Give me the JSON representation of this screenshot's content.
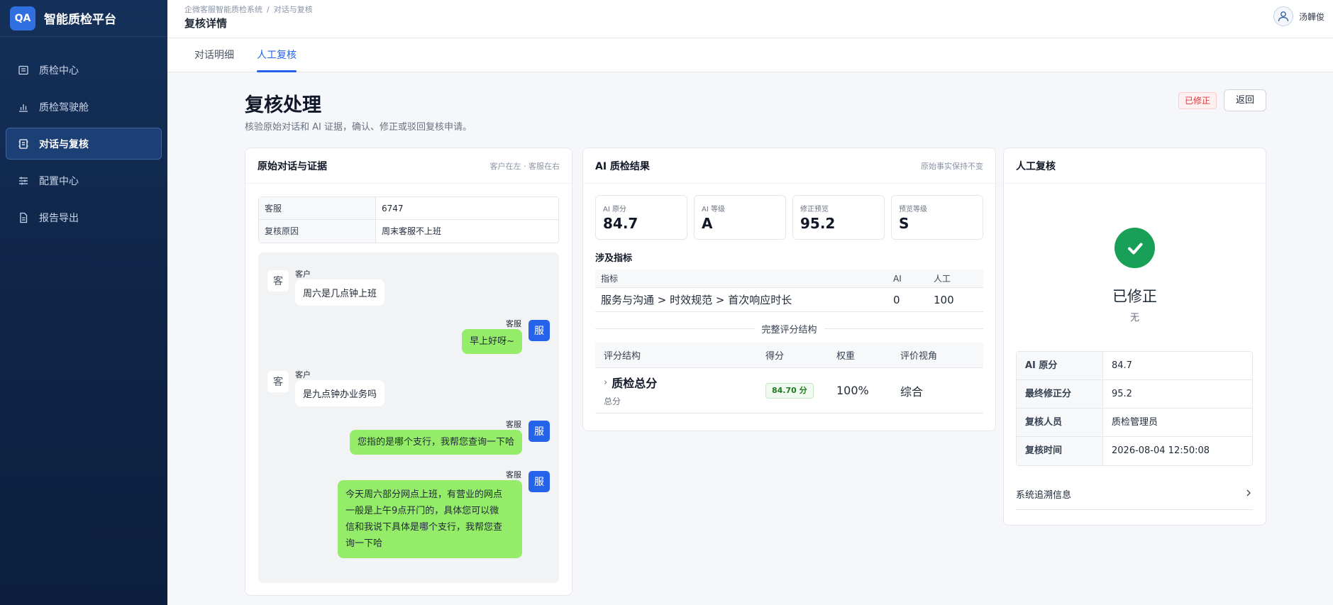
{
  "brand": {
    "logo": "QA",
    "name": "智能质检平台"
  },
  "sidebar": {
    "items": [
      {
        "label": "质检中心",
        "icon": "list-icon"
      },
      {
        "label": "质检驾驶舱",
        "icon": "bar-chart-icon"
      },
      {
        "label": "对话与复核",
        "icon": "chat-review-icon",
        "active": true
      },
      {
        "label": "配置中心",
        "icon": "sliders-icon"
      },
      {
        "label": "报告导出",
        "icon": "document-icon"
      }
    ]
  },
  "header": {
    "breadcrumb": [
      "企微客服智能质检系统",
      "对话与复核"
    ],
    "title": "复核详情",
    "user": "汤韡俊"
  },
  "tabs": [
    {
      "label": "对话明细"
    },
    {
      "label": "人工复核",
      "active": true
    }
  ],
  "main": {
    "title": "复核处理",
    "subtitle": "核验原始对话和 AI 证据，确认、修正或驳回复核申请。",
    "status_tag": "已修正",
    "back_label": "返回"
  },
  "left_card": {
    "title": "原始对话与证据",
    "extra": "客户在左 · 客服在右",
    "info": [
      {
        "key": "客服",
        "value": "6747"
      },
      {
        "key": "复核原因",
        "value": "周末客服不上班"
      }
    ],
    "messages": [
      {
        "role": "customer",
        "avatar": "客",
        "sender": "客户",
        "text": "周六是几点钟上班"
      },
      {
        "role": "agent",
        "avatar": "服",
        "sender": "客服",
        "text": "早上好呀~"
      },
      {
        "role": "customer",
        "avatar": "客",
        "sender": "客户",
        "text": "是九点钟办业务吗"
      },
      {
        "role": "agent",
        "avatar": "服",
        "sender": "客服",
        "text": "您指的是哪个支行，我帮您查询一下哈"
      },
      {
        "role": "agent",
        "avatar": "服",
        "sender": "客服",
        "lines": [
          "今天周六部分网点上班，有营业的网点",
          "一般是上午9点开门的，具体您可以微",
          "信和我说下具体是哪个支行，我帮您查",
          "询一下哈"
        ]
      }
    ]
  },
  "mid_card": {
    "title": "AI 质检结果",
    "extra": "原始事实保持不变",
    "stats": [
      {
        "label": "AI 原分",
        "value": "84.7"
      },
      {
        "label": "AI 等级",
        "value": "A"
      },
      {
        "label": "修正预览",
        "value": "95.2"
      },
      {
        "label": "预览等级",
        "value": "S"
      }
    ],
    "indicator_title": "涉及指标",
    "indicator_head": {
      "name": "指标",
      "ai": "AI",
      "human": "人工"
    },
    "indicator_rows": [
      {
        "name": "服务与沟通 > 时效规范 > 首次响应时长",
        "ai": "0",
        "human": "100"
      }
    ],
    "divider_label": "完整评分结构",
    "score_head": {
      "structure": "评分结构",
      "score": "得分",
      "weight": "权重",
      "view": "评价视角"
    },
    "score_rows": [
      {
        "name": "质检总分",
        "sub": "总分",
        "score": "84.70 分",
        "weight": "100%",
        "view": "综合"
      }
    ]
  },
  "right_card": {
    "title": "人工复核",
    "status": "已修正",
    "note": "无",
    "info": [
      {
        "key": "AI 原分",
        "value": "84.7"
      },
      {
        "key": "最终修正分",
        "value": "95.2"
      },
      {
        "key": "复核人员",
        "value": "质检管理员"
      },
      {
        "key": "复核时间",
        "value": "2026-08-04 12:50:08"
      }
    ],
    "trace_label": "系统追溯信息"
  },
  "colors": {
    "accent": "#2563eb",
    "success": "#18a058",
    "bubble_agent": "#95ec69",
    "sidebar": "#0f2547"
  }
}
